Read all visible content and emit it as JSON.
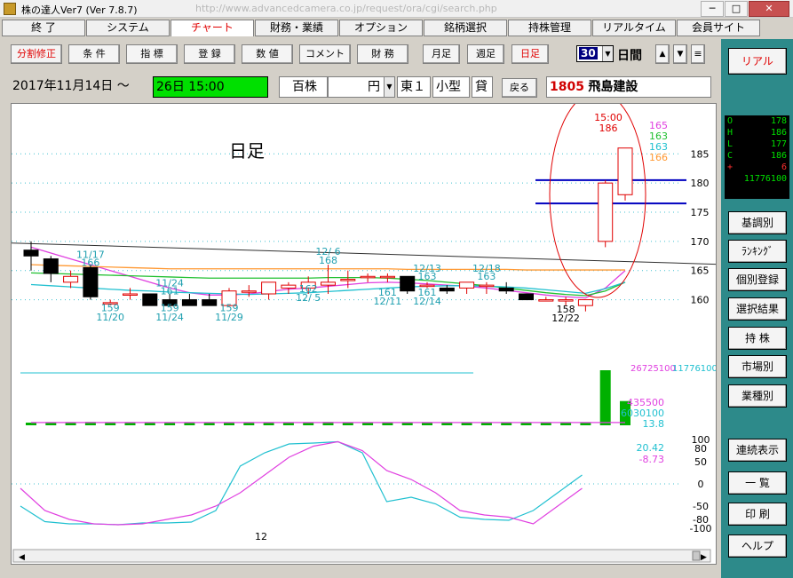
{
  "window": {
    "title": "株の達人Ver7 (Ver 7.8.7)",
    "url": "http://www.advancedcamera.co.jp/request/ora/cgi/search.php"
  },
  "menu": [
    {
      "label": "終 了"
    },
    {
      "label": "システム"
    },
    {
      "label": "チャート"
    },
    {
      "label": "財務・業績"
    },
    {
      "label": "オプション"
    },
    {
      "label": "銘柄選択"
    },
    {
      "label": "持株管理"
    },
    {
      "label": "リアルタイム"
    },
    {
      "label": "会員サイト"
    }
  ],
  "toolbar": {
    "buttons": [
      "分割修正",
      "条 件",
      "指 標",
      "登 録",
      "数 値",
      "コメント",
      "財 務",
      "月足",
      "週足",
      "日足"
    ],
    "period_value": "30",
    "period_unit": "日間",
    "up": "▲",
    "down": "▼",
    "menu": "≡"
  },
  "info": {
    "date": "2017年11月14日 ～",
    "range": "26日 15:00",
    "unit": "百株",
    "currency": "円",
    "market": "東１",
    "size": "小型",
    "lending": "貸",
    "back": "戻る",
    "code": "1805",
    "name": "飛島建設"
  },
  "right_panel": {
    "realtime": "リアル",
    "ohlc": [
      {
        "k": "O",
        "v": "178"
      },
      {
        "k": "H",
        "v": "186"
      },
      {
        "k": "L",
        "v": "177"
      },
      {
        "k": "C",
        "v": "186"
      },
      {
        "k": "+",
        "v": "6"
      }
    ],
    "volume": "11776100",
    "buttons": [
      "基調別",
      "ﾗﾝｷﾝｸﾞ",
      "個別登録",
      "選択結果",
      "持 株",
      "市場別",
      "業種別",
      "連続表示",
      "一 覧",
      "印 刷",
      "ヘルプ"
    ]
  },
  "colors": {
    "up_candle": "#e00000",
    "down_candle": "#000000",
    "ma_short": "#e040e0",
    "ma_mid": "#20c030",
    "ma_long": "#ff9933",
    "ma_cyan": "#20c0d0",
    "blue_line": "#0000c0",
    "panel": "#2d8a8a"
  },
  "chart_data": {
    "type": "candlestick",
    "label": "日足",
    "time_label": "15:00",
    "top_value": "186",
    "ma_values": [
      {
        "v": "165",
        "color": "#e040e0"
      },
      {
        "v": "163",
        "color": "#20c030"
      },
      {
        "v": "163",
        "color": "#20c0d0"
      },
      {
        "v": "166",
        "color": "#ff9933"
      }
    ],
    "ylim": [
      154,
      189
    ],
    "yticks": [
      160,
      165,
      170,
      175,
      180,
      185
    ],
    "hlines": [
      180.5,
      176.5
    ],
    "trend": [
      [
        0,
        168.5
      ],
      [
        31,
        167.3
      ]
    ],
    "candles": [
      {
        "o": 168.5,
        "h": 170,
        "l": 165,
        "c": 167.5
      },
      {
        "o": 167,
        "h": 167.5,
        "l": 163,
        "c": 164.5
      },
      {
        "o": 163,
        "h": 165,
        "l": 162,
        "c": 164
      },
      {
        "o": 165.5,
        "h": 166,
        "l": 160,
        "c": 160.5
      },
      {
        "o": 159.5,
        "h": 160,
        "l": 159,
        "c": 159.5
      },
      {
        "o": 161,
        "h": 162,
        "l": 160,
        "c": 161
      },
      {
        "o": 161,
        "h": 161,
        "l": 159,
        "c": 159
      },
      {
        "o": 160,
        "h": 161,
        "l": 159,
        "c": 159
      },
      {
        "o": 160,
        "h": 161,
        "l": 159,
        "c": 159
      },
      {
        "o": 160,
        "h": 161,
        "l": 159,
        "c": 159
      },
      {
        "o": 159,
        "h": 162,
        "l": 159,
        "c": 161.5
      },
      {
        "o": 161.5,
        "h": 162.5,
        "l": 160.5,
        "c": 161.5
      },
      {
        "o": 161,
        "h": 163,
        "l": 160,
        "c": 163
      },
      {
        "o": 162,
        "h": 163,
        "l": 161,
        "c": 162.5
      },
      {
        "o": 162,
        "h": 164,
        "l": 161,
        "c": 163
      },
      {
        "o": 162.5,
        "h": 166,
        "l": 161,
        "c": 163
      },
      {
        "o": 163.5,
        "h": 165,
        "l": 162,
        "c": 163.5
      },
      {
        "o": 164,
        "h": 164.5,
        "l": 163,
        "c": 164
      },
      {
        "o": 164,
        "h": 164.5,
        "l": 163,
        "c": 164
      },
      {
        "o": 164,
        "h": 164,
        "l": 161,
        "c": 161.5
      },
      {
        "o": 162.5,
        "h": 163,
        "l": 162,
        "c": 162.5
      },
      {
        "o": 162,
        "h": 162.5,
        "l": 161,
        "c": 161.5
      },
      {
        "o": 162,
        "h": 163,
        "l": 161,
        "c": 163
      },
      {
        "o": 162.5,
        "h": 163,
        "l": 161,
        "c": 162.5
      },
      {
        "o": 162,
        "h": 163,
        "l": 161,
        "c": 161.5
      },
      {
        "o": 161,
        "h": 161,
        "l": 160,
        "c": 160
      },
      {
        "o": 160,
        "h": 160.5,
        "l": 160,
        "c": 160
      },
      {
        "o": 160,
        "h": 160.5,
        "l": 159,
        "c": 160
      },
      {
        "o": 159,
        "h": 159.5,
        "l": 158,
        "c": 160
      },
      {
        "o": 170,
        "h": 180.5,
        "l": 169,
        "c": 180
      },
      {
        "o": 178,
        "h": 186,
        "l": 177,
        "c": 186
      }
    ],
    "annotations": [
      {
        "i": 3,
        "v": 167.2,
        "text": "11/17",
        "color": "#20a0b0"
      },
      {
        "i": 3,
        "v": 165.8,
        "text": "166",
        "color": "#20a0b0"
      },
      {
        "i": 4,
        "v": 158,
        "text": "159",
        "color": "#20a0b0"
      },
      {
        "i": 4,
        "v": 156.4,
        "text": "11/20",
        "color": "#20a0b0"
      },
      {
        "i": 7,
        "v": 162.3,
        "text": "11/24",
        "color": "#20a0b0"
      },
      {
        "i": 7,
        "v": 160.9,
        "text": "161",
        "color": "#20a0b0"
      },
      {
        "i": 7,
        "v": 158,
        "text": "159",
        "color": "#20a0b0"
      },
      {
        "i": 7,
        "v": 156.4,
        "text": "11/24",
        "color": "#20a0b0"
      },
      {
        "i": 10,
        "v": 158,
        "text": "159",
        "color": "#20a0b0"
      },
      {
        "i": 10,
        "v": 156.4,
        "text": "11/29",
        "color": "#20a0b0"
      },
      {
        "i": 15,
        "v": 167.7,
        "text": "12/ 6",
        "color": "#20a0b0"
      },
      {
        "i": 15,
        "v": 166.2,
        "text": "168",
        "color": "#20a0b0"
      },
      {
        "i": 14,
        "v": 161.3,
        "text": "162",
        "color": "#20a0b0"
      },
      {
        "i": 14,
        "v": 159.8,
        "text": "12/ 5",
        "color": "#20a0b0"
      },
      {
        "i": 18,
        "v": 160.7,
        "text": "161",
        "color": "#20a0b0"
      },
      {
        "i": 18,
        "v": 159.2,
        "text": "12/11",
        "color": "#20a0b0"
      },
      {
        "i": 20,
        "v": 164.8,
        "text": "12/13",
        "color": "#20a0b0"
      },
      {
        "i": 20,
        "v": 163.4,
        "text": "163",
        "color": "#20a0b0"
      },
      {
        "i": 20,
        "v": 160.7,
        "text": "161",
        "color": "#20a0b0"
      },
      {
        "i": 20,
        "v": 159.2,
        "text": "12/14",
        "color": "#20a0b0"
      },
      {
        "i": 23,
        "v": 164.8,
        "text": "12/18",
        "color": "#20a0b0"
      },
      {
        "i": 23,
        "v": 163.4,
        "text": "163",
        "color": "#20a0b0"
      },
      {
        "i": 27,
        "v": 157.8,
        "text": "158",
        "color": "#000000"
      },
      {
        "i": 27,
        "v": 156.3,
        "text": "12/22",
        "color": "#000000"
      }
    ],
    "ma": [
      {
        "name": "ma_short",
        "color": "#e040e0",
        "values": [
          169,
          168,
          167,
          166,
          165,
          164,
          163,
          162,
          161.2,
          160.8,
          160.8,
          161,
          161.4,
          161.8,
          162,
          162.3,
          162.6,
          162.9,
          163,
          162.9,
          162.7,
          162.5,
          162.3,
          162,
          161.6,
          161.2,
          160.8,
          160.5,
          160.3,
          162,
          165
        ]
      },
      {
        "name": "ma_mid",
        "color": "#20c030",
        "values": [
          164.6,
          164.5,
          164.4,
          164.3,
          164.2,
          164.1,
          164,
          163.9,
          163.8,
          163.7,
          163.7,
          163.7,
          163.7,
          163.7,
          163.7,
          163.8,
          163.8,
          163.8,
          163.7,
          163.5,
          163.3,
          163,
          162.7,
          162.4,
          162,
          161.6,
          161.2,
          160.9,
          160.7,
          161.5,
          163
        ]
      },
      {
        "name": "ma_long",
        "color": "#ff9933",
        "values": [
          166,
          165.9,
          165.8,
          165.7,
          165.6,
          165.5,
          165.4,
          165.3,
          165.3,
          165.3,
          165.3,
          165.3,
          165.3,
          165.3,
          165.3,
          165.3,
          165.3,
          165.3,
          165.3,
          165.2,
          165.2,
          165.2,
          165.2,
          165.2,
          165.2,
          165.1,
          165.1,
          165.1,
          165.1,
          165.1,
          165.1
        ]
      },
      {
        "name": "ma_cyan",
        "color": "#20c0d0",
        "values": [
          162.6,
          162.4,
          162.2,
          162,
          161.8,
          161.6,
          161.5,
          161.3,
          161.2,
          161.1,
          161,
          160.9,
          161,
          161.1,
          161.2,
          161.4,
          161.6,
          161.8,
          162,
          162.2,
          162.3,
          162.4,
          162.4,
          162.3,
          162.2,
          162,
          161.7,
          161.4,
          161.1,
          161.9,
          163
        ]
      }
    ],
    "volume_values": [
      "26725100",
      "11776100"
    ],
    "volume_labels": [
      "435500",
      "6030100",
      "13.8"
    ],
    "volume": [
      0.04,
      0.05,
      0.04,
      0.06,
      0.05,
      0.05,
      0.04,
      0.04,
      0.05,
      0.04,
      0.05,
      0.04,
      0.04,
      0.05,
      0.05,
      0.06,
      0.05,
      0.05,
      0.05,
      0.04,
      0.04,
      0.04,
      0.04,
      0.04,
      0.04,
      0.04,
      0.04,
      0.04,
      0.04,
      1.0,
      0.44
    ],
    "volume_ma": [
      0.05,
      0.05,
      0.05,
      0.05,
      0.05,
      0.05,
      0.05,
      0.05,
      0.05,
      0.05,
      0.05,
      0.05,
      0.05,
      0.05,
      0.05,
      0.05,
      0.05,
      0.05,
      0.05,
      0.05,
      0.05,
      0.05,
      0.05,
      0.05,
      0.05,
      0.05,
      0.05,
      0.05,
      0.05,
      0.05,
      0.05
    ],
    "osc_values": [
      "20.42",
      "-8.73"
    ],
    "osc_yticks": [
      100,
      80,
      50,
      0,
      -50,
      -80,
      -100
    ],
    "osc_k": [
      -50,
      -85,
      -90,
      -90,
      -92,
      -88,
      -88,
      -86,
      -60,
      40,
      70,
      90,
      92,
      95,
      70,
      -40,
      -30,
      -45,
      -75,
      -80,
      -82,
      -60,
      -20,
      20
    ],
    "osc_d": [
      -10,
      -60,
      -80,
      -90,
      -92,
      -90,
      -80,
      -70,
      -50,
      -20,
      20,
      60,
      85,
      95,
      75,
      30,
      10,
      -20,
      -60,
      -70,
      -75,
      -90,
      -50,
      -10
    ],
    "x_label": "12"
  }
}
